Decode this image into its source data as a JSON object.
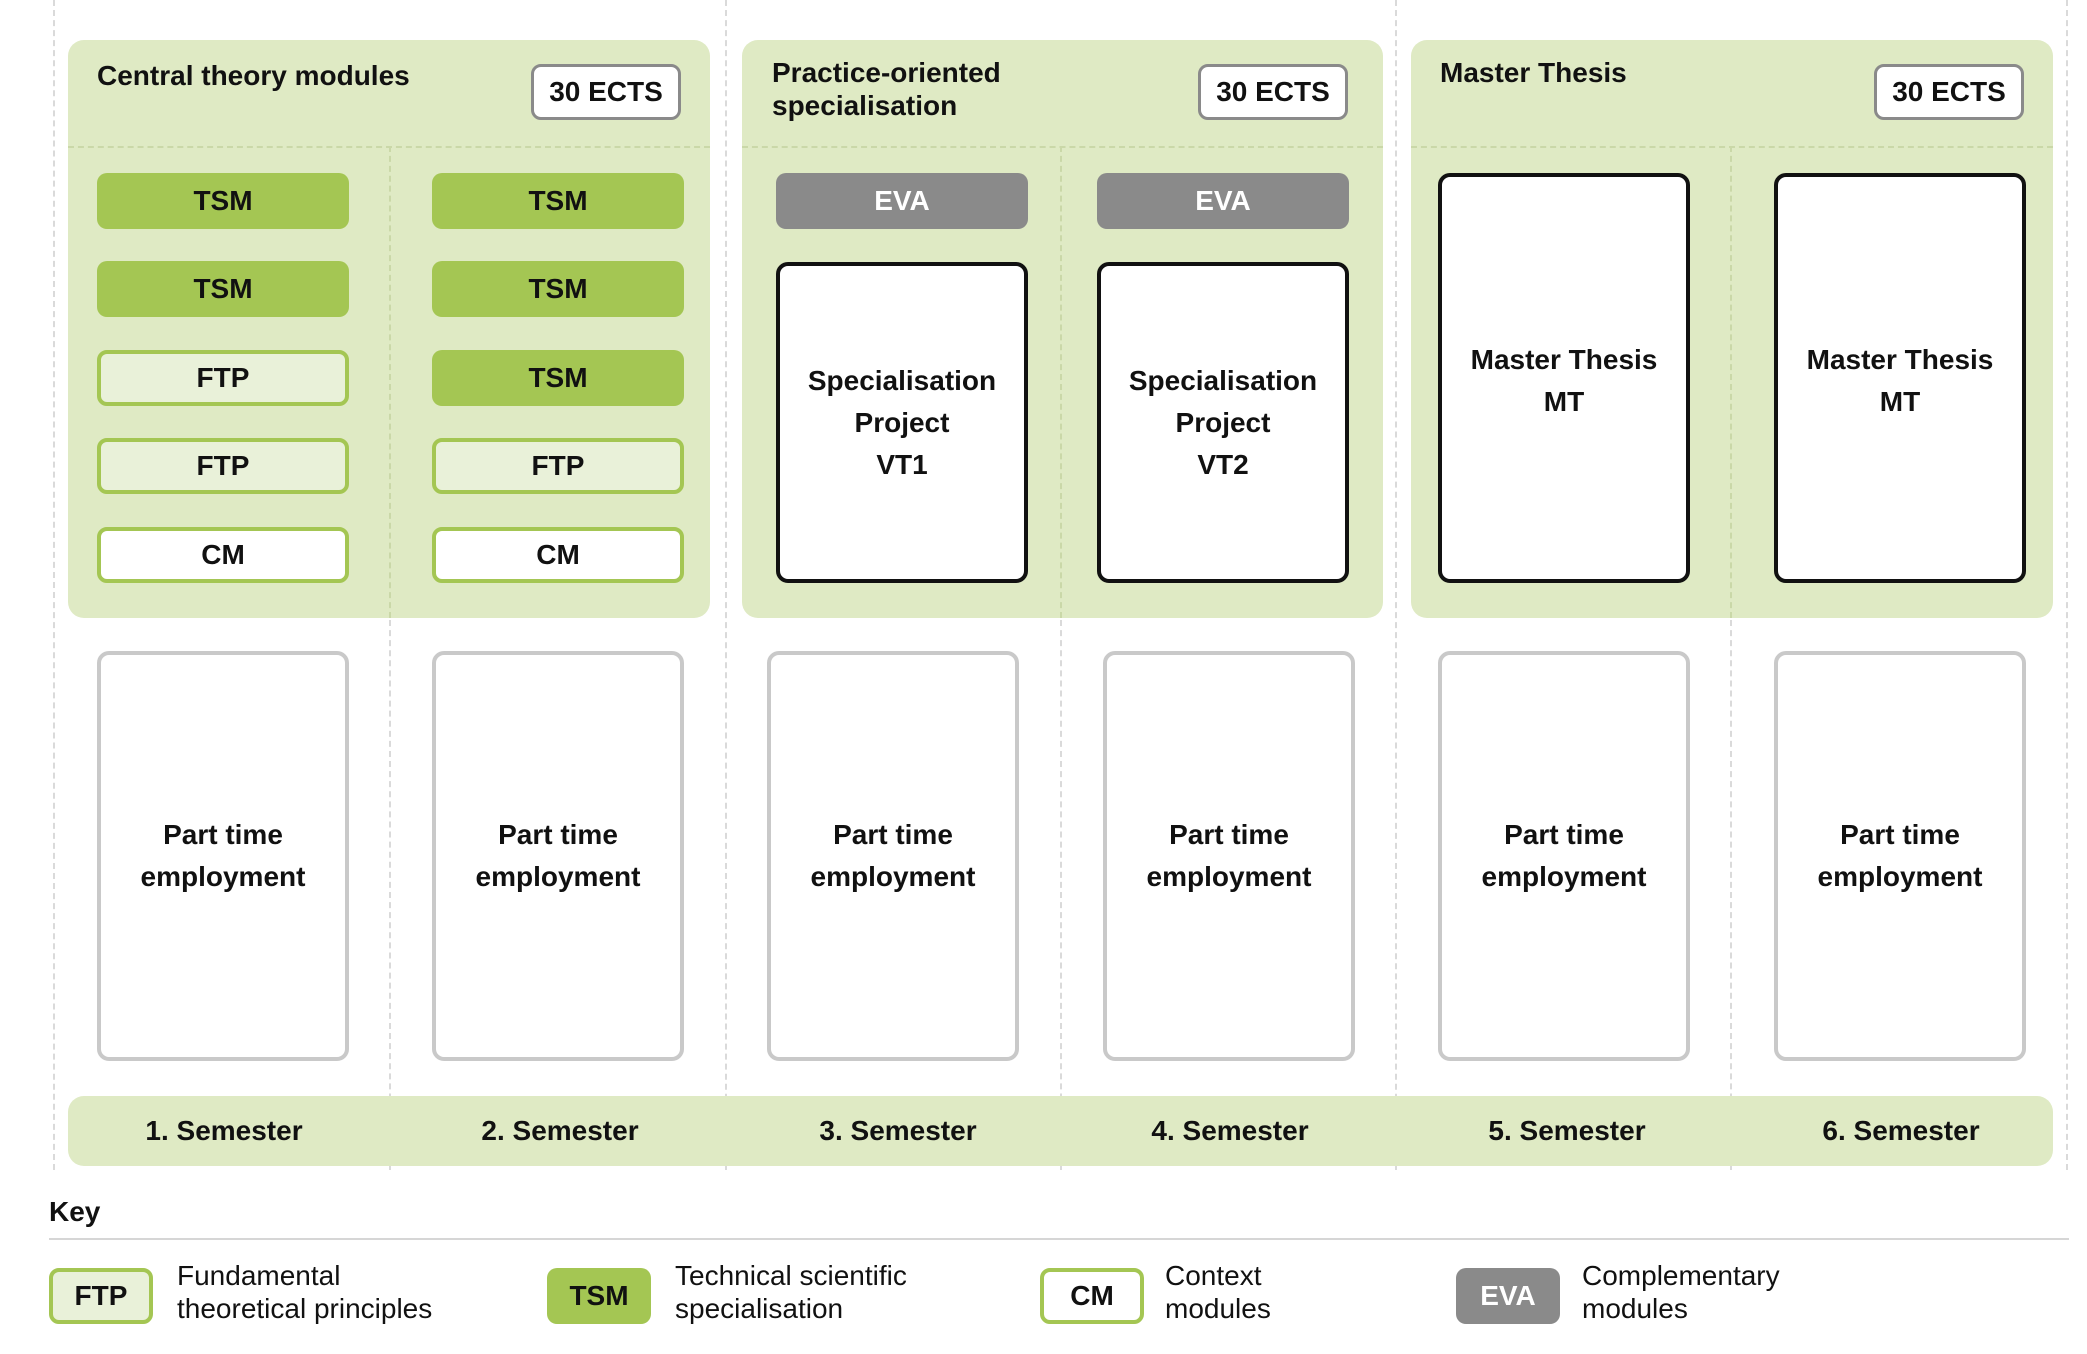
{
  "groups": [
    {
      "title": "Central theory modules",
      "ects": "30 ECTS"
    },
    {
      "title_lines": [
        "Practice-oriented",
        "specialisation"
      ],
      "ects": "30 ECTS"
    },
    {
      "title": "Master Thesis",
      "ects": "30 ECTS"
    }
  ],
  "semesters": [
    {
      "label": "1. Semester",
      "modules": [
        "TSM",
        "TSM",
        "FTP",
        "FTP",
        "CM"
      ]
    },
    {
      "label": "2. Semester",
      "modules": [
        "TSM",
        "TSM",
        "TSM",
        "FTP",
        "CM"
      ]
    },
    {
      "label": "3. Semester",
      "eva": "EVA",
      "project_lines": [
        "Specialisation",
        "Project",
        "VT1"
      ]
    },
    {
      "label": "4. Semester",
      "eva": "EVA",
      "project_lines": [
        "Specialisation",
        "Project",
        "VT2"
      ]
    },
    {
      "label": "5. Semester",
      "thesis_lines": [
        "Master Thesis",
        "MT"
      ]
    },
    {
      "label": "6. Semester",
      "thesis_lines": [
        "Master Thesis",
        "MT"
      ]
    }
  ],
  "part_time_lines": [
    "Part time",
    "employment"
  ],
  "colors": {
    "group_background": "#dfeac4",
    "tsm": "#a4c653",
    "ftp_fill": "#e9f1d9",
    "eva": "#8a8a8a",
    "part_time_border": "#c9c9c9"
  },
  "key": {
    "title": "Key",
    "items": [
      {
        "badge": "FTP",
        "lines": [
          "Fundamental",
          "theoretical principles"
        ]
      },
      {
        "badge": "TSM",
        "lines": [
          "Technical scientific",
          "specialisation"
        ]
      },
      {
        "badge": "CM",
        "lines": [
          "Context",
          "modules"
        ]
      },
      {
        "badge": "EVA",
        "lines": [
          "Complementary",
          "modules"
        ]
      }
    ]
  }
}
